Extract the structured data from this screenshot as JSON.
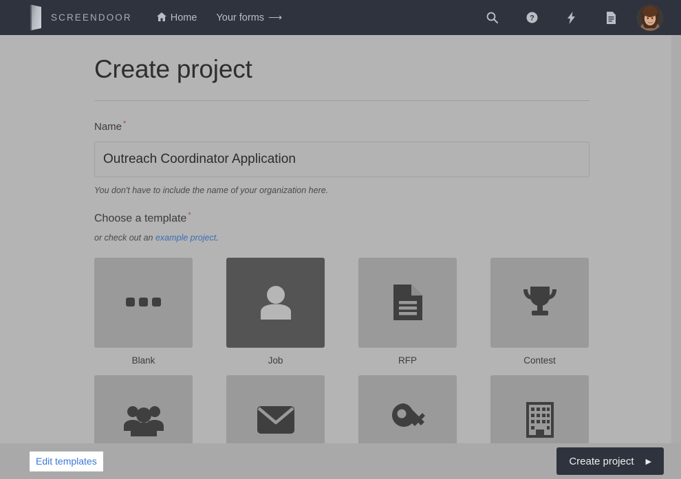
{
  "navbar": {
    "logo_icon": "door-logo-icon",
    "brand": "SCREENDOOR",
    "links": [
      {
        "label": "Home",
        "icon": "home-icon"
      },
      {
        "label": "Your forms",
        "icon": "arrow-right-icon",
        "arrow": "⟶"
      }
    ],
    "icons": [
      {
        "name": "search-icon"
      },
      {
        "name": "help-circle-icon"
      },
      {
        "name": "bolt-icon"
      },
      {
        "name": "document-icon"
      }
    ],
    "avatar": {
      "name": "user-avatar"
    },
    "bg_color": "#2f333d"
  },
  "main": {
    "title": "Create project",
    "name_field": {
      "label": "Name",
      "required_mark": "*",
      "value": "Outreach Coordinator Application",
      "placeholder": "",
      "help": "You don't have to include the name of your organization here."
    },
    "template_section": {
      "label": "Choose a template",
      "required_mark": "*",
      "sub_prefix": "or check out an ",
      "sub_link": "example project",
      "sub_suffix": "."
    },
    "templates": [
      {
        "label": "Blank",
        "icon": "ellipsis-icon",
        "selected": false
      },
      {
        "label": "Job",
        "icon": "person-icon",
        "selected": true
      },
      {
        "label": "RFP",
        "icon": "document-icon",
        "selected": false
      },
      {
        "label": "Contest",
        "icon": "trophy-icon",
        "selected": false
      },
      {
        "label": "",
        "icon": "people-icon",
        "selected": false
      },
      {
        "label": "",
        "icon": "envelope-icon",
        "selected": false
      },
      {
        "label": "",
        "icon": "key-icon",
        "selected": false
      },
      {
        "label": "",
        "icon": "building-icon",
        "selected": false
      }
    ]
  },
  "footer": {
    "edit_templates": "Edit templates",
    "create_button": "Create project",
    "create_caret": "▶"
  },
  "colors": {
    "navbar_bg": "#2f333d",
    "page_bg": "#b4b4b4",
    "footer_bg": "#a9a9a9",
    "link_blue": "#3b6fb5",
    "required_red": "#a8415b",
    "tile_bg": "#9a9a9a",
    "tile_selected_bg": "#545454"
  }
}
